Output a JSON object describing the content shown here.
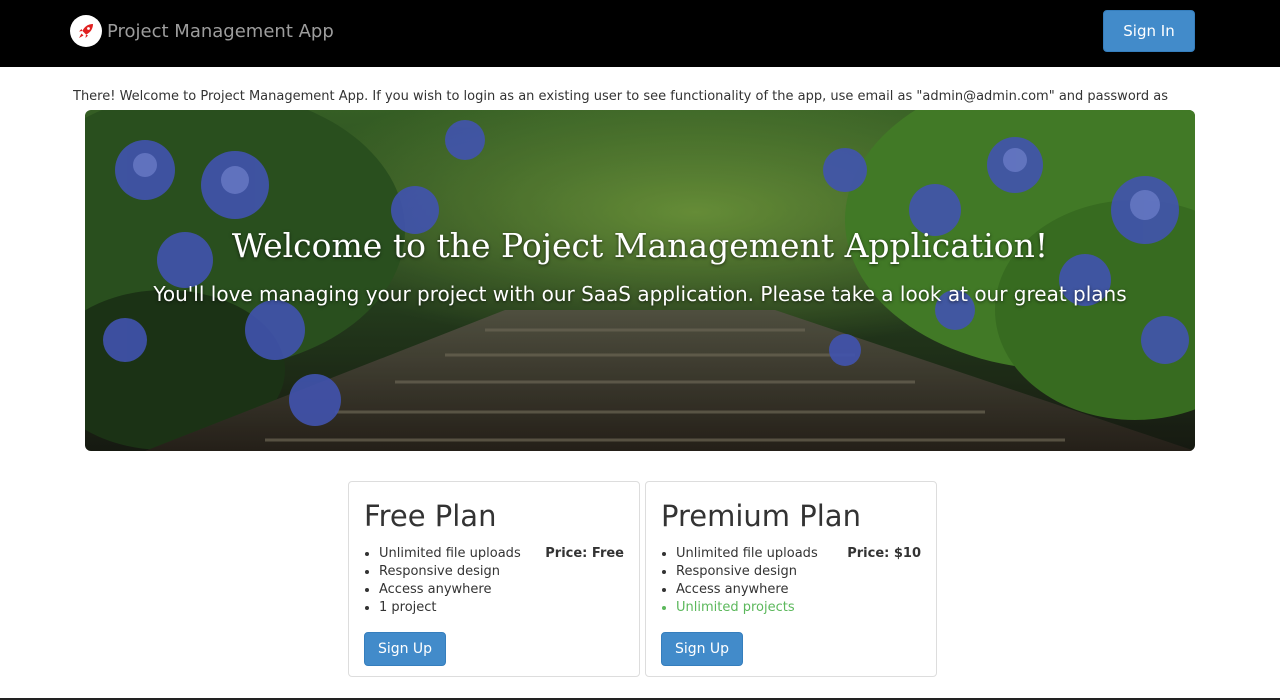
{
  "navbar": {
    "brand": "Project Management App",
    "brand_icon": "rocket-icon",
    "signin_label": "Sign In"
  },
  "notice": "There! Welcome to Project Management App. If you wish to login as an existing user to see functionality of the app, use email as \"admin@admin.com\" and password as",
  "hero": {
    "title": "Welcome to the Poject Management Application!",
    "subtitle": "You'll love managing your project with our SaaS application. Please take a look at our great plans"
  },
  "plans": [
    {
      "title": "Free Plan",
      "price": "Price: Free",
      "features": [
        "Unlimited file uploads",
        "Responsive design",
        "Access anywhere",
        "1 project"
      ],
      "signup_label": "Sign Up"
    },
    {
      "title": "Premium Plan",
      "price": "Price: $10",
      "features": [
        "Unlimited file uploads",
        "Responsive design",
        "Access anywhere",
        "Unlimited projects"
      ],
      "signup_label": "Sign Up"
    }
  ],
  "colors": {
    "navbar_bg": "#000000",
    "primary": "#428bca",
    "highlight_green": "#5cb85c",
    "logo_red": "#e02020"
  }
}
